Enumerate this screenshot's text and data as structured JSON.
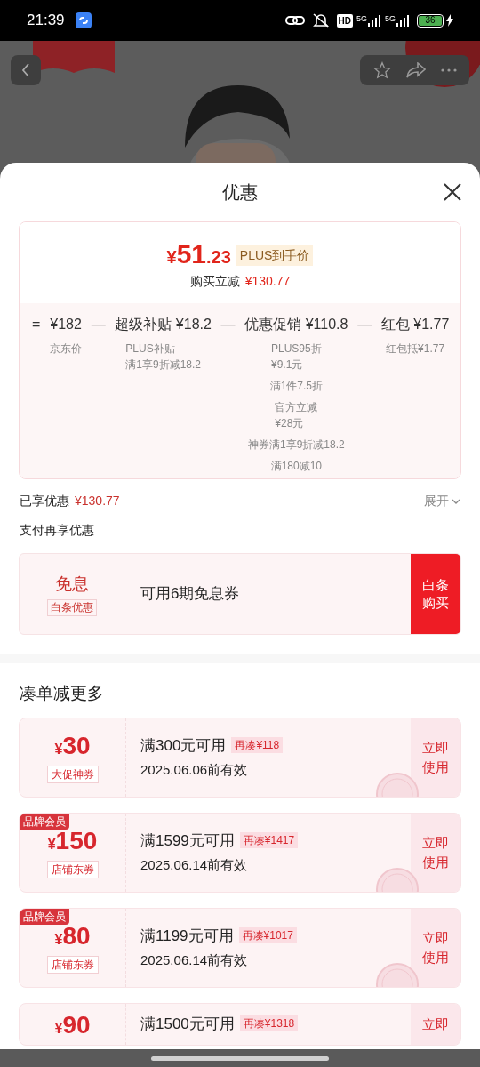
{
  "status_bar": {
    "time": "21:39",
    "network_labels": [
      "HD",
      "5G",
      "5G"
    ],
    "battery": "36"
  },
  "sheet": {
    "title": "优惠",
    "price_card": {
      "currency": "¥",
      "price_main": "51",
      "price_decimal": ".23",
      "price_tag": "PLUS到手价",
      "saving_label": "购买立减",
      "saving_amount": "¥130.77",
      "breakdown": [
        {
          "operator": "=",
          "label": "¥182",
          "details": [
            [
              "京东价"
            ]
          ]
        },
        {
          "operator": "—",
          "label": "超级补贴 ¥18.2",
          "details": [
            [
              "PLUS补贴",
              "满1享9折减18.2"
            ]
          ]
        },
        {
          "operator": "—",
          "label": "优惠促销 ¥110.8",
          "details": [
            [
              "PLUS95折",
              "¥9.1元"
            ],
            [
              "满1件7.5折"
            ],
            [
              "官方立减",
              "¥28元"
            ],
            [
              "神券满1享9折减18.2"
            ],
            [
              "满180减10"
            ]
          ]
        },
        {
          "operator": "—",
          "label": "红包 ¥1.77",
          "details": [
            [
              "红包抵¥1.77"
            ]
          ]
        }
      ]
    },
    "enjoyed": {
      "label": "已享优惠",
      "amount": "¥130.77",
      "toggle": "展开",
      "expanded": false
    },
    "pay_section_title": "支付再享优惠",
    "baitiao": {
      "title": "免息",
      "tag": "白条优惠",
      "description": "可用6期免息券",
      "button": [
        "白条",
        "购买"
      ]
    },
    "coupons_title": "凑单减更多",
    "coupons": [
      {
        "currency": "¥",
        "amount": "30",
        "tag": "大促神券",
        "condition": "满300元可用",
        "extra": "再凑¥118",
        "expiry": "2025.06.06前有效",
        "action": [
          "立即",
          "使用"
        ],
        "stamped": true
      },
      {
        "badge": "品牌会员",
        "currency": "¥",
        "amount": "150",
        "tag": "店铺东券",
        "condition": "满1599元可用",
        "extra": "再凑¥1417",
        "expiry": "2025.06.14前有效",
        "action": [
          "立即",
          "使用"
        ],
        "stamped": true
      },
      {
        "badge": "品牌会员",
        "currency": "¥",
        "amount": "80",
        "tag": "店铺东券",
        "condition": "满1199元可用",
        "extra": "再凑¥1017",
        "expiry": "2025.06.14前有效",
        "action": [
          "立即",
          "使用"
        ],
        "stamped": true
      },
      {
        "currency": "¥",
        "amount": "90",
        "condition": "满1500元可用",
        "extra": "再凑¥1318",
        "action": [
          "立即"
        ],
        "stamped": false
      }
    ]
  }
}
